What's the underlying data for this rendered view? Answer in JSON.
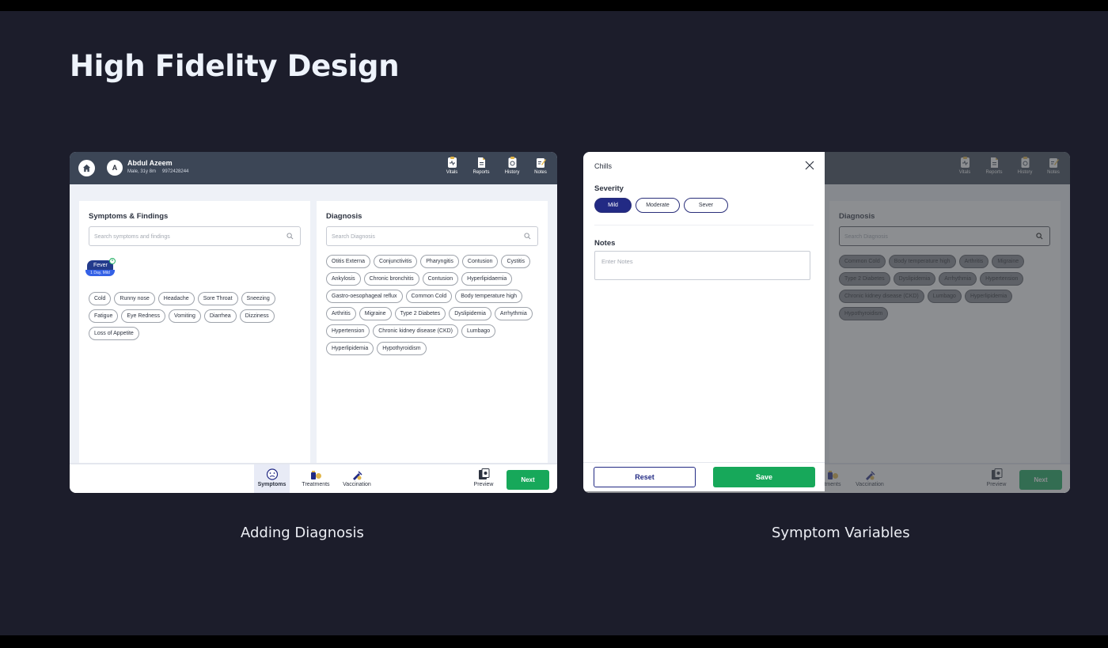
{
  "page": {
    "title": "High Fidelity Design"
  },
  "captions": {
    "left": "Adding Diagnosis",
    "right": "Symptom Variables"
  },
  "patient": {
    "avatar_letter": "A",
    "name": "Abdul Azeem",
    "info": "Male, 31y 8m",
    "phone": "9972428244"
  },
  "toolbar": {
    "vitals": "Vitals",
    "reports": "Reports",
    "history": "History",
    "notes": "Notes"
  },
  "symptoms": {
    "title": "Symptoms & Findings",
    "search_placeholder": "Search symptoms and findings",
    "selected": {
      "label": "Fever",
      "detail": "1 Day, Mild"
    },
    "chips": [
      "Cold",
      "Runny nose",
      "Headache",
      "Sore Throat",
      "Sneezing",
      "Fatigue",
      "Eye Redness",
      "Vomiting",
      "Diarrhea",
      "Dizziness",
      "Loss of Appetite"
    ]
  },
  "diagnosis": {
    "title": "Diagnosis",
    "search_placeholder": "Search Diagnosis",
    "chips": [
      "Otitis Externa",
      "Conjunctivitis",
      "Pharyngitis",
      "Contusion",
      "Cystitis",
      "Ankylosis",
      "Chronic bronchitis",
      "Contusion",
      "Hyperlipidaemia",
      "Gastro-oesophageal reflux",
      "Common Cold",
      "Body temperature high",
      "Arthritis",
      "Migraine",
      "Type 2 Diabetes",
      "Dyslipidemia",
      "Arrhythmia",
      "Hypertension",
      "Chronic kidney disease (CKD)",
      "Lumbago",
      "Hyperlipidemia",
      "Hypothyroidism"
    ],
    "right_chips": [
      "Common Cold",
      "Body temperature high",
      "Arthritis",
      "Migraine",
      "Type 2 Diabetes",
      "Dyslipidemia",
      "Arrhythmia",
      "Hypertension",
      "Chronic kidney disease (CKD)",
      "Lumbago",
      "Hyperlipidemia",
      "Hypothyroidism"
    ]
  },
  "bottom_nav": {
    "symptoms": "Symptoms",
    "treatments": "Treatments",
    "treatments_cut": "tments",
    "vaccination": "Vaccination",
    "preview": "Preview",
    "next": "Next"
  },
  "modal": {
    "title": "Chills",
    "severity_label": "Severity",
    "severity_options": [
      "Mild",
      "Moderate",
      "Sever"
    ],
    "selected_severity": "Mild",
    "notes_label": "Notes",
    "notes_placeholder": "Enter Notes",
    "reset": "Reset",
    "save": "Save"
  },
  "colors": {
    "background": "#1c1d2b",
    "topbar": "#3c4656",
    "primary": "#222a84",
    "accent_green": "#17a85a"
  }
}
